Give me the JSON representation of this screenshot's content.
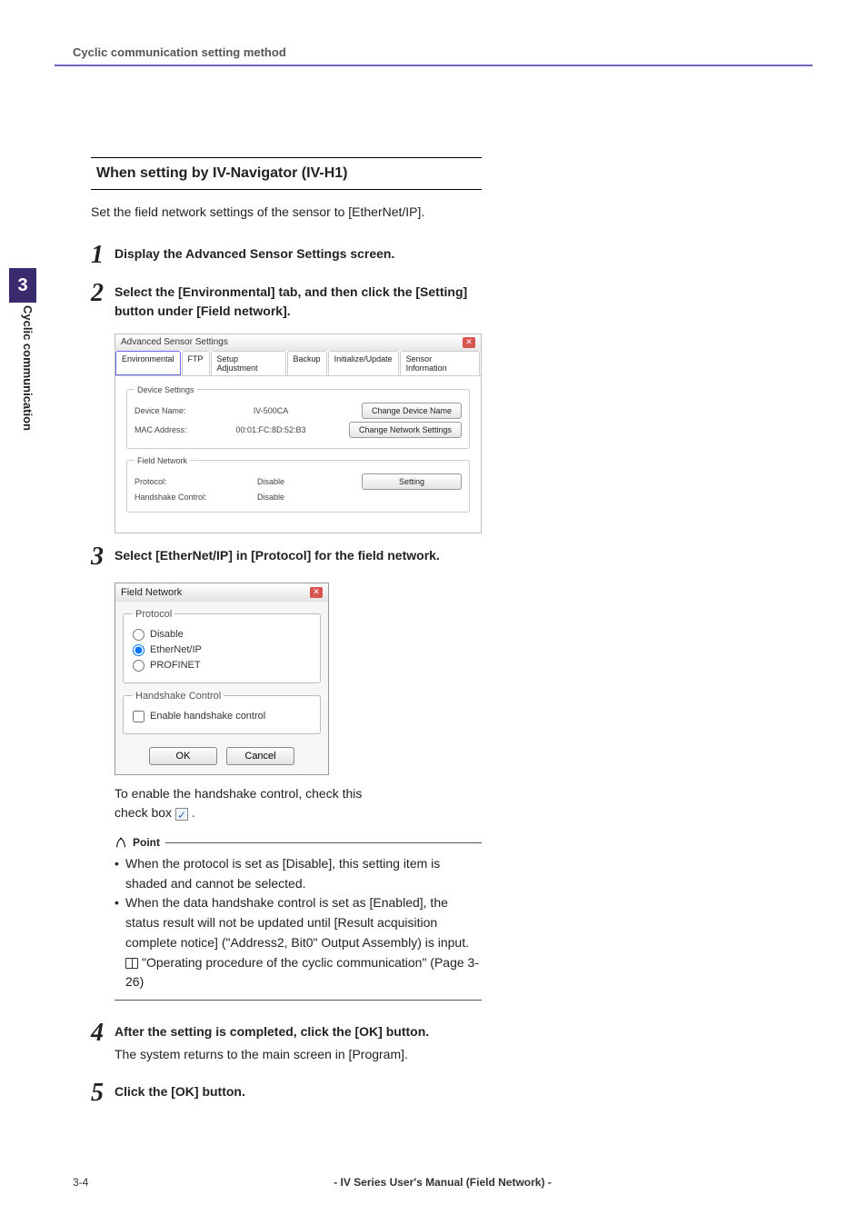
{
  "running_head": "Cyclic communication setting method",
  "sidetab": {
    "num": "3",
    "label": "Cyclic communication"
  },
  "subhead": "When setting by IV-Navigator (IV-H1)",
  "intro": "Set the field network settings of the sensor to [EtherNet/IP].",
  "steps": {
    "s1": {
      "num": "1",
      "title": "Display the Advanced Sensor Settings screen."
    },
    "s2": {
      "num": "2",
      "title": "Select the [Environmental] tab, and then click the [Setting] button under [Field network]."
    },
    "s3": {
      "num": "3",
      "title": "Select [EtherNet/IP] in [Protocol] for the field network."
    },
    "s4": {
      "num": "4",
      "title": "After the setting is completed, click the [OK] button.",
      "text": "The system returns to the main screen in [Program]."
    },
    "s5": {
      "num": "5",
      "title": "Click the [OK] button."
    }
  },
  "shot1": {
    "title": "Advanced Sensor Settings",
    "tabs": [
      "Environmental",
      "FTP",
      "Setup Adjustment",
      "Backup",
      "Initialize/Update",
      "Sensor Information"
    ],
    "device_settings": {
      "legend": "Device Settings",
      "name_label": "Device Name:",
      "name_value": "IV-500CA",
      "mac_label": "MAC Address:",
      "mac_value": "00:01:FC:8D:52:B3",
      "btn_change_name": "Change Device Name",
      "btn_change_net": "Change Network Settings"
    },
    "field_network": {
      "legend": "Field Network",
      "protocol_label": "Protocol:",
      "protocol_value": "Disable",
      "handshake_label": "Handshake Control:",
      "handshake_value": "Disable",
      "btn_setting": "Setting"
    }
  },
  "shot2": {
    "title": "Field Network",
    "protocol_legend": "Protocol",
    "opt_disable": "Disable",
    "opt_ethernetip": "EtherNet/IP",
    "opt_profinet": "PROFINET",
    "hc_legend": "Handshake Control",
    "hc_check": "Enable handshake control",
    "btn_ok": "OK",
    "btn_cancel": "Cancel"
  },
  "after_shot2_line1": "To enable the handshake control, check this",
  "after_shot2_line2_prefix": "check box ",
  "after_shot2_line2_suffix": " .",
  "point": {
    "label": "Point",
    "item1": "When the protocol is set as [Disable], this setting item is shaded and cannot be selected.",
    "item2": "When the data handshake control is set as [Enabled], the status result will not be updated until [Result acquisition complete notice] (\"Address2, Bit0\" Output Assembly) is input.",
    "ref": "\"Operating procedure of the cyclic communication\" (Page 3-26)"
  },
  "footer": {
    "page": "3-4",
    "title": "- IV Series User's Manual (Field Network) -"
  }
}
